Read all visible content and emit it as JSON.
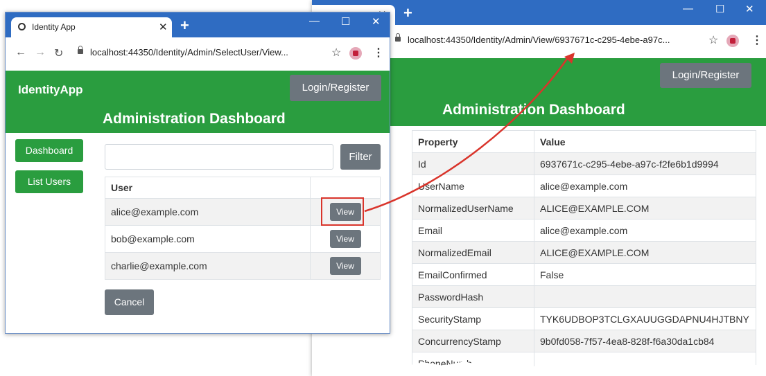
{
  "window_left": {
    "tab_title": "Identity App",
    "url": "localhost:44350/Identity/Admin/SelectUser/View...",
    "brand": "IdentityApp",
    "login_label": "Login/Register",
    "heading": "Administration Dashboard",
    "sidebar": [
      "Dashboard",
      "List Users"
    ],
    "filter_value": "",
    "filter_label": "Filter",
    "table_header": "User",
    "users": [
      "alice@example.com",
      "bob@example.com",
      "charlie@example.com"
    ],
    "view_label": "View",
    "cancel_label": "Cancel"
  },
  "window_right": {
    "url": "localhost:44350/Identity/Admin/View/6937671c-c295-4ebe-a97c...",
    "login_label": "Login/Register",
    "heading": "Administration Dashboard",
    "columns": [
      "Property",
      "Value"
    ],
    "rows": [
      {
        "property": "Id",
        "value": "6937671c-c295-4ebe-a97c-f2fe6b1d9994"
      },
      {
        "property": "UserName",
        "value": "alice@example.com"
      },
      {
        "property": "NormalizedUserName",
        "value": "ALICE@EXAMPLE.COM"
      },
      {
        "property": "Email",
        "value": "alice@example.com"
      },
      {
        "property": "NormalizedEmail",
        "value": "ALICE@EXAMPLE.COM"
      },
      {
        "property": "EmailConfirmed",
        "value": "False"
      },
      {
        "property": "PasswordHash",
        "value": ""
      },
      {
        "property": "SecurityStamp",
        "value": "TYK6UDBOP3TCLGXAUUGGDAPNU4HJTBNY"
      },
      {
        "property": "ConcurrencyStamp",
        "value": "9b0fd058-7f57-4ea8-828f-f6a30da1cb84"
      },
      {
        "property": "PhoneNumb",
        "value": ""
      }
    ]
  },
  "colors": {
    "chrome": "#2f6cc2",
    "banner": "#2a9d3f",
    "button": "#6c757d",
    "callout": "#d9342b"
  },
  "icons": [
    "globe-icon",
    "close-icon",
    "plus-icon",
    "minimize-icon",
    "maximize-icon",
    "back-icon",
    "forward-icon",
    "reload-icon",
    "lock-icon",
    "star-icon",
    "extension-icon",
    "menu-icon"
  ]
}
